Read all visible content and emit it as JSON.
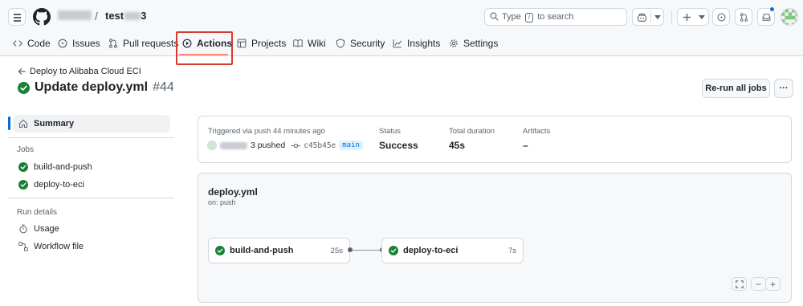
{
  "repo": {
    "name_visible": "test"
  },
  "search": {
    "prefix": "Type",
    "key": "/",
    "suffix": "to search"
  },
  "nav": {
    "code": "Code",
    "issues": "Issues",
    "pull_requests": "Pull requests",
    "actions": "Actions",
    "projects": "Projects",
    "wiki": "Wiki",
    "security": "Security",
    "insights": "Insights",
    "settings": "Settings"
  },
  "run": {
    "back_link": "Deploy to Alibaba Cloud ECI",
    "title": "Update deploy.yml",
    "number": "#44",
    "rerun_button": "Re-run all jobs",
    "more_button": "···"
  },
  "sidebar": {
    "summary": "Summary",
    "jobs_heading": "Jobs",
    "jobs": [
      "build-and-push",
      "deploy-to-eci"
    ],
    "details_heading": "Run details",
    "usage": "Usage",
    "workflow_file": "Workflow file"
  },
  "summary": {
    "triggered": "Triggered via push 44 minutes ago",
    "actor_suffix": "3 pushed",
    "commit": "c45b45e",
    "branch": "main",
    "status_label": "Status",
    "status_value": "Success",
    "duration_label": "Total duration",
    "duration_value": "45s",
    "artifacts_label": "Artifacts",
    "artifacts_value": "–"
  },
  "workflow": {
    "file": "deploy.yml",
    "trigger": "on: push",
    "jobs": [
      {
        "name": "build-and-push",
        "duration": "25s"
      },
      {
        "name": "deploy-to-eci",
        "duration": "7s"
      }
    ],
    "zoom_minus": "−",
    "zoom_plus": "+"
  },
  "colors": {
    "success": "#1a7f37",
    "accent": "#0969da",
    "tab_underline": "#fd8c73",
    "highlight_box": "#d73a2f"
  }
}
